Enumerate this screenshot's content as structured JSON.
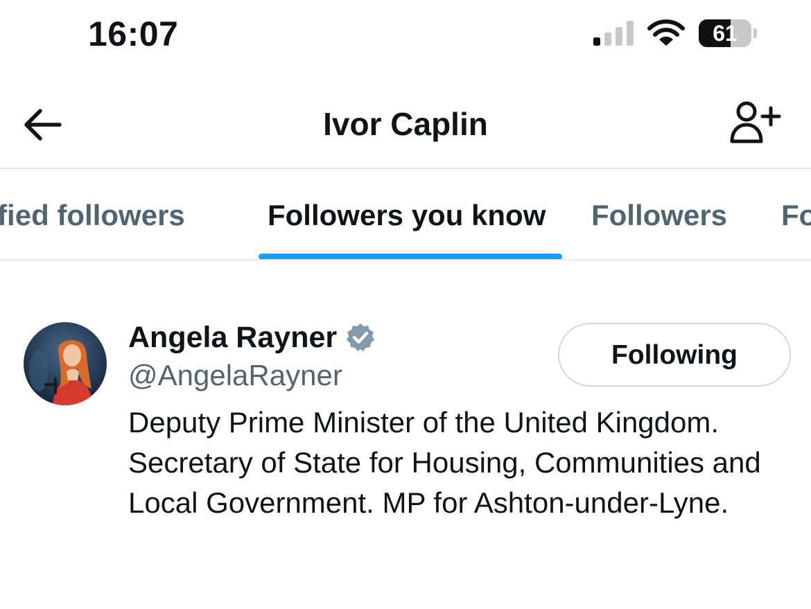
{
  "status_bar": {
    "time": "16:07",
    "battery_percent": "61",
    "battery_level": 0.61,
    "signal_bars_active": 1,
    "signal_bars_total": 4
  },
  "header": {
    "title": "Ivor Caplin",
    "back_icon": "arrow-left-icon",
    "add_icon": "person-add-icon"
  },
  "tabs": [
    {
      "label": "Verified followers",
      "active": false
    },
    {
      "label": "Followers you know",
      "active": true
    },
    {
      "label": "Followers",
      "active": false
    },
    {
      "label": "Following",
      "active": false
    }
  ],
  "users": [
    {
      "name": "Angela Rayner",
      "handle": "@AngelaRayner",
      "verified": true,
      "follow_button_label": "Following",
      "bio": "Deputy Prime Minister of the United Kingdom. Secretary of State for Housing, Communities and Local Government. MP for Ashton-under-Lyne."
    }
  ],
  "colors": {
    "accent": "#1d9bf0",
    "text_primary": "#0f1419",
    "text_secondary": "#536471",
    "divider": "#e6e8ea",
    "verified_badge": "#829aab"
  }
}
